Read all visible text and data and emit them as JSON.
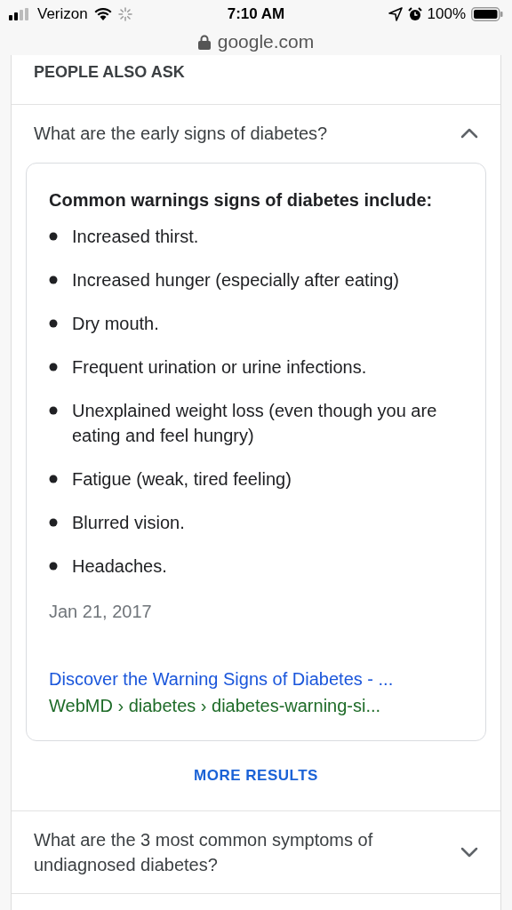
{
  "status_bar": {
    "carrier": "Verizon",
    "time": "7:10 AM",
    "battery": "100%"
  },
  "address_bar": {
    "url": "google.com"
  },
  "section_title": "PEOPLE ALSO ASK",
  "questions": [
    {
      "text": "What are the early signs of diabetes?",
      "expanded": true,
      "answer": {
        "heading": "Common warnings signs of diabetes include:",
        "items": [
          "Increased thirst.",
          "Increased hunger (especially after eating)",
          "Dry mouth.",
          "Frequent urination or urine infections.",
          "Unexplained weight loss (even though you are eating and feel hungry)",
          "Fatigue (weak, tired feeling)",
          "Blurred vision.",
          "Headaches."
        ],
        "date": "Jan 21, 2017",
        "link": "Discover the Warning Signs of Diabetes - ...",
        "breadcrumb": "WebMD › diabetes › diabetes-warning-si..."
      },
      "more_button": "MORE RESULTS"
    },
    {
      "text": "What are the 3 most common symptoms of undiagnosed diabetes?",
      "expanded": false
    }
  ]
}
